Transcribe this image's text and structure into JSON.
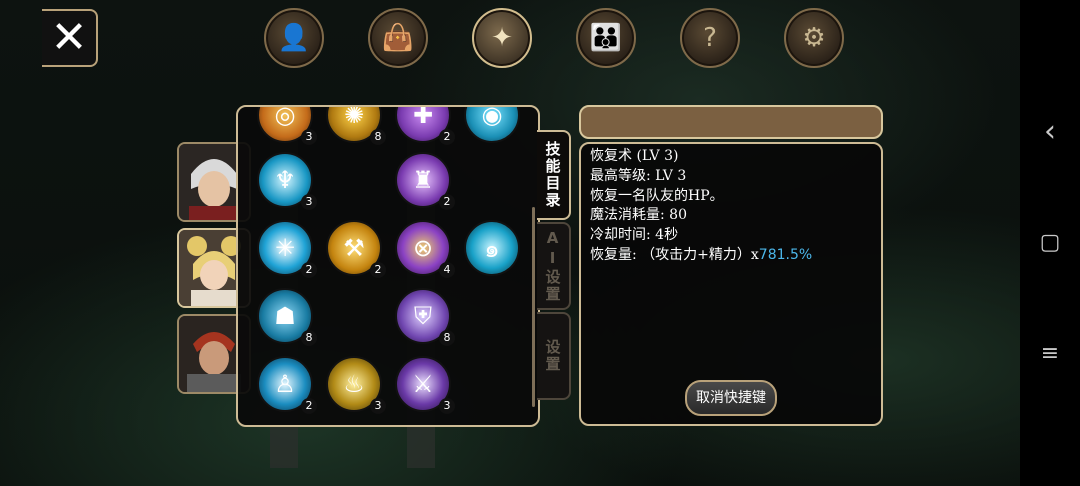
{
  "header": {
    "close_icon": "✕",
    "tabs": [
      {
        "icon": "character-icon",
        "glyph": "👤"
      },
      {
        "icon": "bag-icon",
        "glyph": "👜"
      },
      {
        "icon": "skills-icon",
        "glyph": "✦",
        "active": true
      },
      {
        "icon": "party-icon",
        "glyph": "👪"
      },
      {
        "icon": "quest-scroll-icon",
        "glyph": "?"
      },
      {
        "icon": "settings-gear-icon",
        "glyph": "⚙"
      }
    ]
  },
  "party": [
    {
      "name": "white-haired-hero"
    },
    {
      "name": "blonde-healer",
      "active": true
    },
    {
      "name": "red-haired-warrior"
    }
  ],
  "skills": [
    {
      "icon": "orange-ring-skill",
      "level": "3",
      "color": "#c46b1a"
    },
    {
      "icon": "fire-burst-skill",
      "level": "8",
      "color": "#b07a11"
    },
    {
      "icon": "purple-rune-skill",
      "level": "2",
      "color": "#7a3bb0"
    },
    {
      "icon": "cyan-orb-skill",
      "level": "",
      "color": "#1a8fb5"
    },
    {
      "icon": "heal-wings-skill",
      "level": "3",
      "color": "#1897c4"
    },
    {
      "icon": "purple-armor-skill",
      "level": "2",
      "color": "#7a3bb0"
    },
    {
      "icon": "ice-star-skill",
      "level": "2",
      "color": "#1fa3d6"
    },
    {
      "icon": "golden-hammer-skill",
      "level": "2",
      "color": "#c4840f"
    },
    {
      "icon": "purple-target-skill",
      "level": "4",
      "color": "#8b42c4"
    },
    {
      "icon": "cyan-wind-skill",
      "level": "",
      "color": "#18a1c8"
    },
    {
      "icon": "ice-guardian-skill",
      "level": "8",
      "color": "#197ca3"
    },
    {
      "icon": "holy-shield-skill",
      "level": "8",
      "color": "#7046b0"
    },
    {
      "icon": "ice-spirit-skill",
      "level": "2",
      "color": "#1b8dc0"
    },
    {
      "icon": "golden-aura-skill",
      "level": "3",
      "color": "#b28b17"
    },
    {
      "icon": "purple-sword-skill",
      "level": "3",
      "color": "#6b3aa8"
    }
  ],
  "side_tabs": [
    {
      "label": "技能目录",
      "active": true
    },
    {
      "label": "AI设置"
    },
    {
      "label": "设置"
    }
  ],
  "detail": {
    "title": "",
    "line1": "恢复术 (LV 3)",
    "line2": "最高等级:   LV 3",
    "line3": "恢复一名队友的HP。",
    "line4": "魔法消耗量: 80",
    "line5": "冷却时间: 4秒",
    "line6_prefix": "恢复量: （攻击力+精力）x",
    "line6_value": "781.5%",
    "cancel_label": "取消快捷键"
  },
  "nav": {
    "back_icon": "‹",
    "home_icon": "▢",
    "menu_icon": "≡"
  }
}
